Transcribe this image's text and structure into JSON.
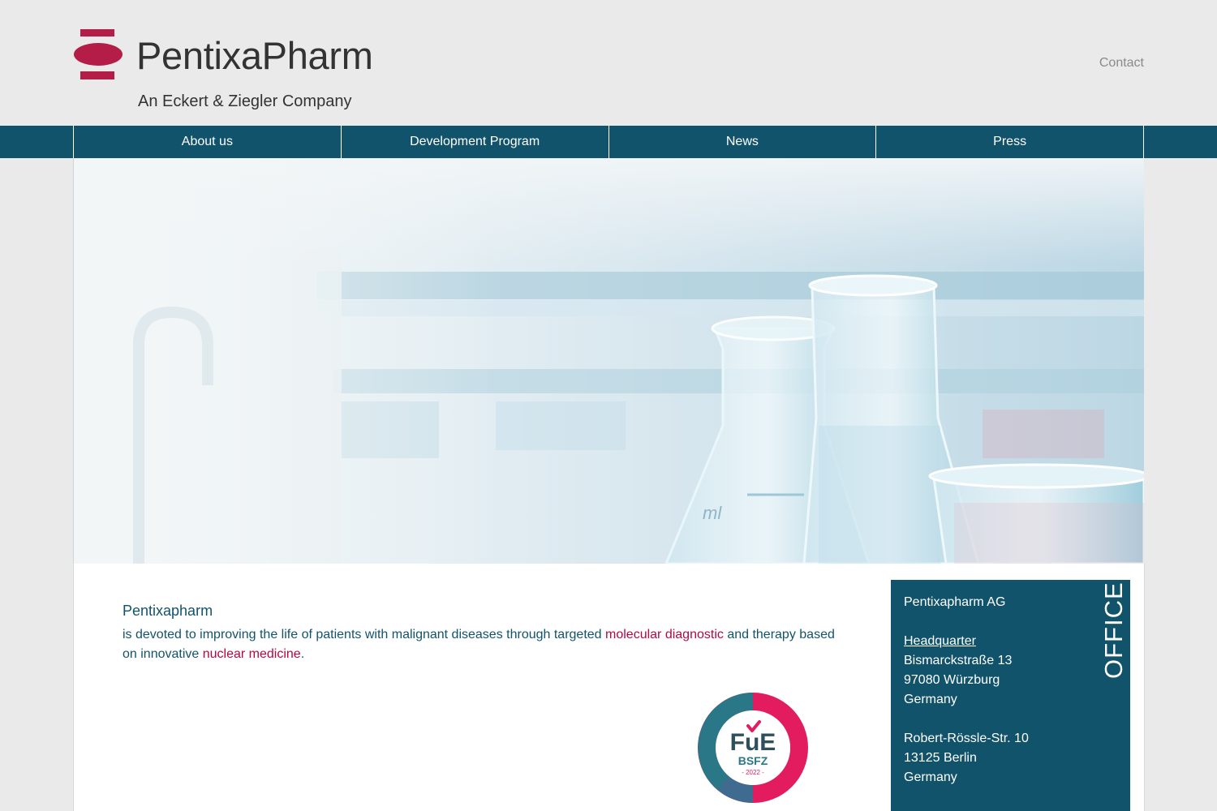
{
  "header": {
    "brand_name": "PentixaPharm",
    "brand_subtitle": "An Eckert & Ziegler Company",
    "contact_label": "Contact"
  },
  "nav": {
    "items": [
      {
        "label": "About us"
      },
      {
        "label": "Development Program"
      },
      {
        "label": "News"
      },
      {
        "label": "Press"
      }
    ]
  },
  "hero": {
    "flask_marking": "ml"
  },
  "intro": {
    "title": "Pentixapharm",
    "text_part1": "is devoted to improving the life of patients with malignant diseases through targeted ",
    "link1": "molecular diagnostic",
    "text_part2": " and therapy based on innovative ",
    "link2": "nuclear medicine",
    "text_part3": "."
  },
  "badge": {
    "main": "FuE",
    "sub": "BSFZ",
    "year": "- 2022 -"
  },
  "office": {
    "label": "OFFICE",
    "company": "Pentixapharm AG",
    "hq_label": "Headquarter",
    "hq_street": "Bismarckstraße 13",
    "hq_city": "97080 Würzburg",
    "hq_country": "Germany",
    "branch_street": "Robert-Rössle-Str. 10",
    "branch_city": "13125 Berlin",
    "branch_country": "Germany"
  },
  "colors": {
    "primary": "#12536c",
    "accent": "#b3093f",
    "background": "#eaeaea"
  }
}
